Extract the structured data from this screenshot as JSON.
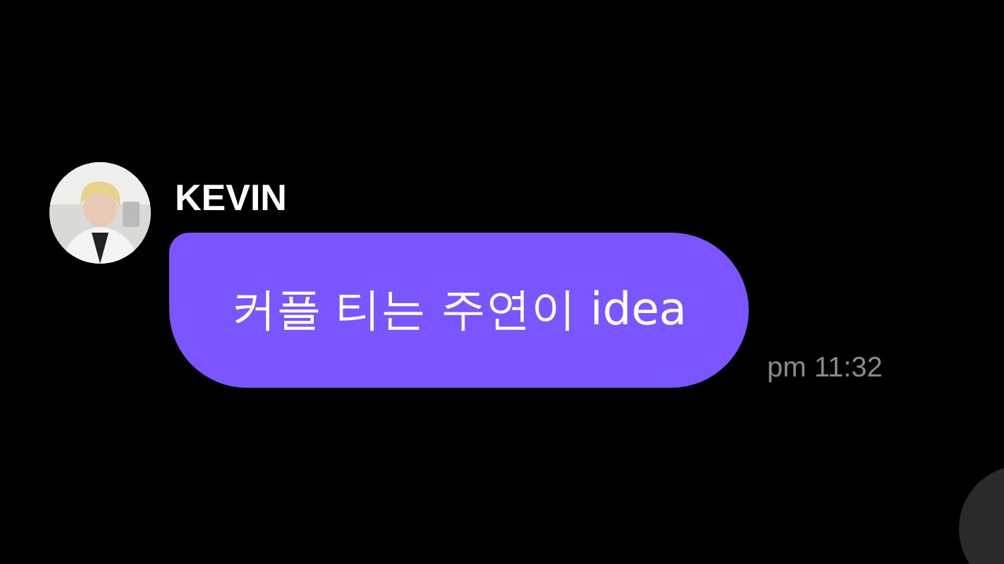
{
  "messages": [
    {
      "sender": "KEVIN",
      "text": "커플 티는 주연이 idea",
      "time": "pm 11:32"
    }
  ]
}
